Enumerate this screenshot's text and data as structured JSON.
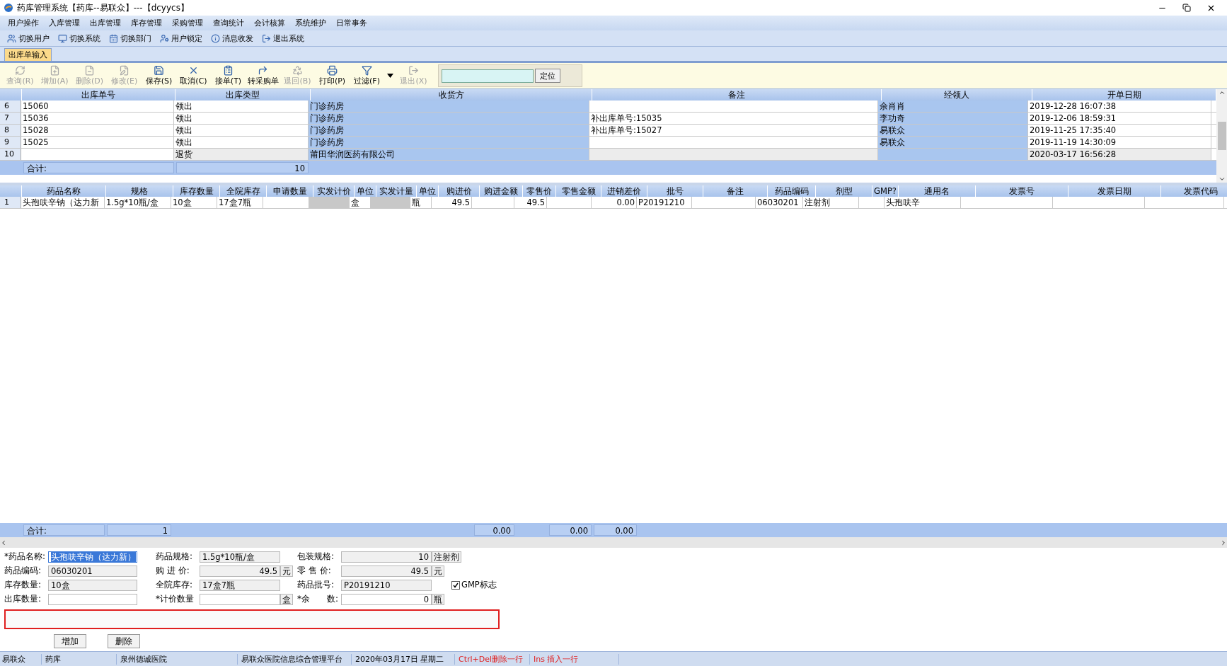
{
  "window": {
    "title": "药库管理系统【药库--易联众】---【dcyycs】"
  },
  "menu": [
    "用户操作",
    "入库管理",
    "出库管理",
    "库存管理",
    "采购管理",
    "查询统计",
    "会计核算",
    "系统维护",
    "日常事务"
  ],
  "quick_toolbar": [
    "切换用户",
    "切换系统",
    "切换部门",
    "用户锁定",
    "消息收发",
    "退出系统"
  ],
  "tabs": [
    {
      "label": "出库单输入",
      "selected": true
    }
  ],
  "actions": [
    {
      "label": "查询(R)",
      "disabled": true
    },
    {
      "label": "增加(A)",
      "disabled": true
    },
    {
      "label": "删除(D)",
      "disabled": true
    },
    {
      "label": "修改(E)",
      "disabled": true
    },
    {
      "label": "保存(S)",
      "disabled": false
    },
    {
      "label": "取消(C)",
      "disabled": false
    },
    {
      "label": "接单(T)",
      "disabled": false
    },
    {
      "label": "转采购单",
      "disabled": false
    },
    {
      "label": "退回(B)",
      "disabled": true
    },
    {
      "label": "打印(P)",
      "disabled": false
    },
    {
      "label": "过滤(F)",
      "disabled": false,
      "dropdown": true
    },
    {
      "label": "退出(X)",
      "disabled": true
    }
  ],
  "locate": {
    "button": "定位"
  },
  "master": {
    "columns": [
      {
        "label": "出库单号",
        "highlight": false
      },
      {
        "label": "出库类型",
        "highlight": false
      },
      {
        "label": "收货方",
        "highlight": true
      },
      {
        "label": "备注",
        "highlight": false
      },
      {
        "label": "经领人",
        "highlight": true
      },
      {
        "label": "开单日期",
        "highlight": false
      }
    ],
    "rows": [
      {
        "number": "6",
        "pending": false,
        "order_no": "15060",
        "type": "领出",
        "receiver": "门诊药房",
        "handler": "余肖肖",
        "date": "2019-12-28 16:07:38"
      },
      {
        "number": "7",
        "pending": false,
        "order_no": "15036",
        "type": "领出",
        "receiver": "门诊药房",
        "remark": "补出库单号:15035",
        "handler": "李功奇",
        "date": "2019-12-06 18:59:31"
      },
      {
        "number": "8",
        "pending": false,
        "order_no": "15028",
        "type": "领出",
        "receiver": "门诊药房",
        "remark": "补出库单号:15027",
        "handler": "易联众",
        "date": "2019-11-25 17:35:40"
      },
      {
        "number": "9",
        "pending": false,
        "order_no": "15025",
        "type": "领出",
        "receiver": "门诊药房",
        "handler": "易联众",
        "date": "2019-11-19 14:30:09"
      },
      {
        "number": "10",
        "pending": true,
        "type": "退货",
        "receiver": "莆田华润医药有限公司",
        "date": "2020-03-17 16:56:28"
      }
    ],
    "total": {
      "label": "合计:",
      "value": "10"
    }
  },
  "detail": {
    "columns": [
      {
        "label": "药品名称",
        "shaded": false
      },
      {
        "label": "规格",
        "shaded": false
      },
      {
        "label": "库存数量",
        "shaded": false
      },
      {
        "label": "全院库存",
        "shaded": false
      },
      {
        "label": "申请数量",
        "shaded": false
      },
      {
        "label": "实发计价",
        "shaded": true
      },
      {
        "label": "单位",
        "shaded": false
      },
      {
        "label": "实发计量",
        "shaded": true
      },
      {
        "label": "单位",
        "shaded": false
      },
      {
        "label": "购进价",
        "shaded": false
      },
      {
        "label": "购进金额",
        "shaded": false
      },
      {
        "label": "零售价",
        "shaded": false
      },
      {
        "label": "零售金额",
        "shaded": false
      },
      {
        "label": "进销差价",
        "shaded": false
      },
      {
        "label": "批号",
        "shaded": false
      },
      {
        "label": "备注",
        "shaded": false
      },
      {
        "label": "药品编码",
        "shaded": false
      },
      {
        "label": "剂型",
        "shaded": false
      },
      {
        "label": "GMP?",
        "shaded": false
      },
      {
        "label": "通用名",
        "shaded": false
      },
      {
        "label": "发票号",
        "shaded": false
      },
      {
        "label": "发票日期",
        "shaded": false
      },
      {
        "label": "发票代码",
        "shaded": false
      }
    ],
    "rows": [
      {
        "number": "1",
        "name": "头孢呋辛钠（达力新",
        "spec": "1.5g*10瓶/盒",
        "stock": "10盒",
        "hospital_stock": "17盒7瓶",
        "price_unit": "盒",
        "measure_unit": "瓶",
        "purchase_price": "49.5",
        "retail_price": "49.5",
        "price_diff": "0.00",
        "batch": "P20191210",
        "code": "06030201",
        "form": "注射剂",
        "generic_name": "头孢呋辛"
      }
    ],
    "total": {
      "label": "合计:",
      "spec": "1",
      "purchase_amount": "0.00",
      "retail_amount": "0.00",
      "price_diff": "0.00"
    }
  },
  "form": {
    "rows": [
      [
        {
          "label": "*药品名称:",
          "value": "头孢呋辛钠（达力新）",
          "kind": "text",
          "editable": true,
          "selected": true
        },
        {
          "label": "药品规格:",
          "value": "1.5g*10瓶/盒",
          "kind": "text",
          "editable": false,
          "selected": false
        },
        {
          "label": "包装规格:",
          "value": "10",
          "kind": "number",
          "unit": "注射剂",
          "editable": false,
          "selected": false
        }
      ],
      [
        {
          "label": "药品编码:",
          "value": "06030201",
          "kind": "text",
          "editable": false,
          "selected": false
        },
        {
          "label": "购 进 价:",
          "value": "49.5",
          "kind": "number",
          "unit": "元",
          "editable": false,
          "selected": false
        },
        {
          "label": "零 售 价:",
          "value": "49.5",
          "kind": "number",
          "unit": "元",
          "editable": false,
          "selected": false
        }
      ],
      [
        {
          "label": "库存数量:",
          "value": "10盒",
          "kind": "text",
          "editable": false,
          "selected": false
        },
        {
          "label": "全院库存:",
          "value": "17盒7瓶",
          "kind": "text",
          "editable": false,
          "selected": false
        },
        {
          "label": "药品批号:",
          "value": "P20191210",
          "kind": "text",
          "editable": false,
          "selected": false
        }
      ],
      [
        {
          "label": "出库数量:",
          "kind": "text",
          "editable": true,
          "selected": false
        },
        {
          "label": "*计价数量",
          "kind": "text",
          "unit": "盒",
          "editable": true,
          "selected": false
        },
        {
          "label": "*余　　数:",
          "value": "0",
          "kind": "number",
          "unit": "瓶",
          "editable": true,
          "selected": false
        }
      ]
    ],
    "gmp": {
      "label": "GMP标志",
      "checked": true
    },
    "buttons": [
      "增加",
      "删除"
    ]
  },
  "status_bar": [
    {
      "text": "易联众",
      "alert": false
    },
    {
      "text": "药库",
      "alert": false
    },
    {
      "text": "泉州德诚医院",
      "alert": false
    },
    {
      "text": "易联众医院信息综合管理平台",
      "alert": false
    },
    {
      "text": "2020年03月17日 星期二",
      "alert": false
    },
    {
      "text": "Ctrl+Del删除一行",
      "alert": true
    },
    {
      "text": "Ins 插入一行",
      "alert": true
    }
  ]
}
